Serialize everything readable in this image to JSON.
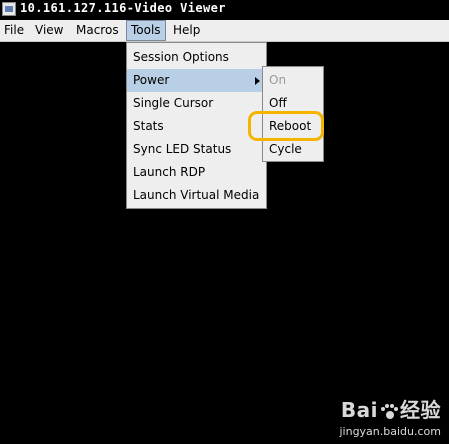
{
  "window": {
    "title": "10.161.127.116-Video Viewer"
  },
  "menubar": {
    "items": [
      "File",
      "View",
      "Macros",
      "Tools",
      "Help"
    ]
  },
  "tools_menu": {
    "items": [
      "Session Options",
      "Power",
      "Single Cursor",
      "Stats",
      "Sync LED Status",
      "Launch RDP",
      "Launch Virtual Media"
    ]
  },
  "power_submenu": {
    "items": [
      "On",
      "Off",
      "Reboot",
      "Cycle"
    ]
  },
  "watermark": {
    "logo_a": "Bai",
    "logo_b": "经验",
    "url": "jingyan.baidu.com"
  },
  "colors": {
    "highlight_ring": "#f5b400",
    "menu_highlight": "#b8cfe5"
  }
}
